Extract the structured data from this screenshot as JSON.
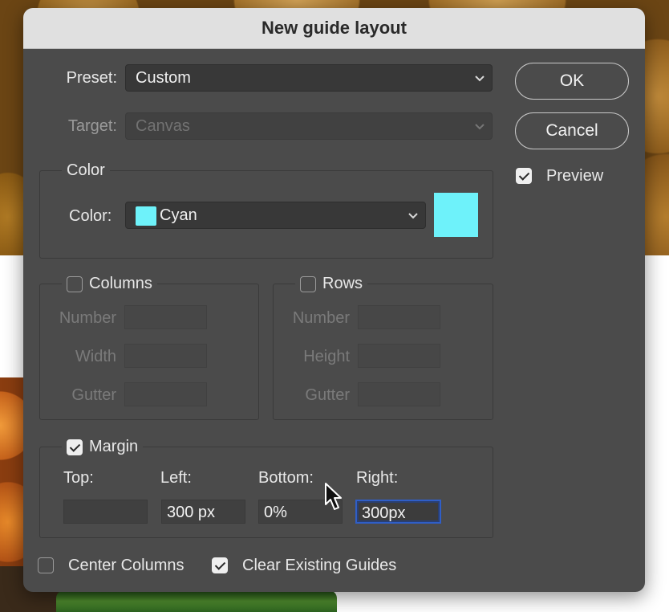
{
  "dialog": {
    "title": "New guide layout"
  },
  "preset": {
    "label": "Preset:",
    "value": "Custom"
  },
  "target": {
    "label": "Target:",
    "value": "Canvas"
  },
  "color_group": {
    "legend": "Color",
    "label": "Color:",
    "value": "Cyan",
    "swatch_color": "#6ef2fa"
  },
  "columns": {
    "label": "Columns",
    "checked": false,
    "fields": [
      {
        "label": "Number",
        "value": ""
      },
      {
        "label": "Width",
        "value": ""
      },
      {
        "label": "Gutter",
        "value": ""
      }
    ]
  },
  "rows": {
    "label": "Rows",
    "checked": false,
    "fields": [
      {
        "label": "Number",
        "value": ""
      },
      {
        "label": "Height",
        "value": ""
      },
      {
        "label": "Gutter",
        "value": ""
      }
    ]
  },
  "margin": {
    "label": "Margin",
    "checked": true,
    "top": {
      "label": "Top:",
      "value": ""
    },
    "left": {
      "label": "Left:",
      "value": "300 px"
    },
    "bottom": {
      "label": "Bottom:",
      "value": "0%"
    },
    "right": {
      "label": "Right:",
      "value": "300px"
    }
  },
  "options": {
    "center_columns": {
      "label": "Center Columns",
      "checked": false
    },
    "clear_existing_guides": {
      "label": "Clear Existing Guides",
      "checked": true
    }
  },
  "buttons": {
    "ok": "OK",
    "cancel": "Cancel"
  },
  "preview": {
    "label": "Preview",
    "checked": true
  },
  "colors": {
    "dialog_bg": "#4b4b4b",
    "titlebar_bg": "#e0e0e0",
    "focus_ring": "#2f5ec7",
    "cyan": "#6ef2fa"
  }
}
